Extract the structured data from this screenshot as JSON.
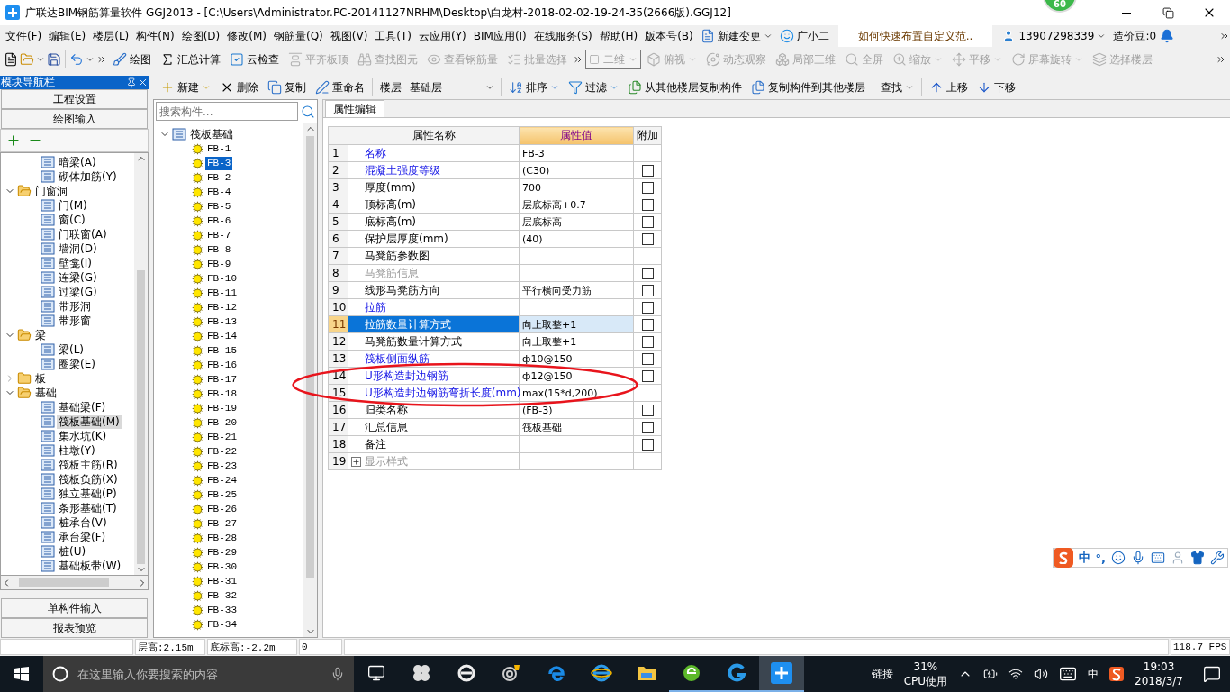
{
  "window": {
    "title": "广联达BIM钢筋算量软件 GGJ2013 - [C:\\Users\\Administrator.PC-20141127NRHM\\Desktop\\白龙村-2018-02-02-19-24-35(2666版).GGJ12]",
    "score_badge": "60"
  },
  "menu": [
    "文件(F)",
    "编辑(E)",
    "楼层(L)",
    "构件(N)",
    "绘图(D)",
    "修改(M)",
    "钢筋量(Q)",
    "视图(V)",
    "工具(T)",
    "云应用(Y)",
    "BIM应用(I)",
    "在线服务(S)",
    "帮助(H)",
    "版本号(B)"
  ],
  "menu_extra": {
    "change": "新建变更",
    "assistant": "广小二",
    "tip": "如何快速布置自定义范..",
    "account": "13907298339",
    "beans": "造价豆:0"
  },
  "toolbar": {
    "items": [
      {
        "label": "绘图",
        "disabled": false
      },
      {
        "label": "汇总计算",
        "disabled": false
      },
      {
        "label": "云检查",
        "disabled": false
      },
      {
        "label": "平齐板顶",
        "disabled": true
      },
      {
        "label": "查找图元",
        "disabled": true
      },
      {
        "label": "查看钢筋量",
        "disabled": true
      },
      {
        "label": "批量选择",
        "disabled": true
      }
    ],
    "view_select": "二维",
    "view_items": [
      {
        "label": "俯视",
        "disabled": true,
        "dropdown": true
      },
      {
        "label": "动态观察",
        "disabled": true,
        "dropdown": false
      },
      {
        "label": "局部三维",
        "disabled": true,
        "dropdown": false
      },
      {
        "label": "全屏",
        "disabled": true,
        "dropdown": false
      },
      {
        "label": "缩放",
        "disabled": true,
        "dropdown": true
      },
      {
        "label": "平移",
        "disabled": true,
        "dropdown": true
      },
      {
        "label": "屏幕旋转",
        "disabled": true,
        "dropdown": true
      },
      {
        "label": "选择楼层",
        "disabled": true,
        "dropdown": false
      }
    ]
  },
  "nav": {
    "title": "模块导航栏",
    "buttons": [
      "工程设置",
      "绘图输入"
    ],
    "bottom_buttons": [
      "单构件输入",
      "报表预览"
    ],
    "tree": [
      {
        "children": [
          {
            "label": "暗梁(A)",
            "selected": false
          },
          {
            "label": "砌体加筋(Y)",
            "selected": false
          }
        ]
      },
      {
        "label": "门窗洞",
        "expanded": true,
        "children": [
          {
            "label": "门(M)",
            "selected": false
          },
          {
            "label": "窗(C)",
            "selected": false
          },
          {
            "label": "门联窗(A)",
            "selected": false
          },
          {
            "label": "墙洞(D)",
            "selected": false
          },
          {
            "label": "壁龛(I)",
            "selected": false
          },
          {
            "label": "连梁(G)",
            "selected": false
          },
          {
            "label": "过梁(G)",
            "selected": false
          },
          {
            "label": "带形洞",
            "selected": false
          },
          {
            "label": "带形窗",
            "selected": false
          }
        ]
      },
      {
        "label": "梁",
        "expanded": true,
        "children": [
          {
            "label": "梁(L)",
            "selected": false
          },
          {
            "label": "圈梁(E)",
            "selected": false
          }
        ]
      },
      {
        "label": "板",
        "expanded": false
      },
      {
        "label": "基础",
        "expanded": true,
        "children": [
          {
            "label": "基础梁(F)",
            "selected": false
          },
          {
            "label": "筏板基础(M)",
            "selected": true
          },
          {
            "label": "集水坑(K)",
            "selected": false
          },
          {
            "label": "柱墩(Y)",
            "selected": false
          },
          {
            "label": "筏板主筋(R)",
            "selected": false
          },
          {
            "label": "筏板负筋(X)",
            "selected": false
          },
          {
            "label": "独立基础(P)",
            "selected": false
          },
          {
            "label": "条形基础(T)",
            "selected": false
          },
          {
            "label": "桩承台(V)",
            "selected": false
          },
          {
            "label": "承台梁(F)",
            "selected": false
          },
          {
            "label": "桩(U)",
            "selected": false
          },
          {
            "label": "基础板带(W)",
            "selected": false
          }
        ]
      }
    ]
  },
  "component_toolbar": {
    "items": [
      {
        "label": "新建",
        "dropdown": true
      },
      {
        "label": "删除",
        "dropdown": false
      },
      {
        "label": "复制",
        "dropdown": false
      },
      {
        "label": "重命名",
        "dropdown": false
      }
    ],
    "floor_label": "楼层",
    "floor_select": "基础层",
    "items2": [
      {
        "label": "排序",
        "dropdown": true
      },
      {
        "label": "过滤",
        "dropdown": true
      },
      {
        "label": "从其他楼层复制构件",
        "dropdown": false
      },
      {
        "label": "复制构件到其他楼层",
        "dropdown": false
      },
      {
        "label": "查找",
        "dropdown": true
      },
      {
        "label": "上移",
        "dropdown": false
      },
      {
        "label": "下移",
        "dropdown": false
      }
    ]
  },
  "component_search": {
    "placeholder": "搜索构件..."
  },
  "component_tree": {
    "label": "筏板基础",
    "expanded": true,
    "children": [
      {
        "label": "FB-1",
        "selected": false
      },
      {
        "label": "FB-3",
        "selected": true
      },
      {
        "label": "FB-2",
        "selected": false
      },
      {
        "label": "FB-4",
        "selected": false
      },
      {
        "label": "FB-5",
        "selected": false
      },
      {
        "label": "FB-6",
        "selected": false
      },
      {
        "label": "FB-7",
        "selected": false
      },
      {
        "label": "FB-8",
        "selected": false
      },
      {
        "label": "FB-9",
        "selected": false
      },
      {
        "label": "FB-10",
        "selected": false
      },
      {
        "label": "FB-11",
        "selected": false
      },
      {
        "label": "FB-12",
        "selected": false
      },
      {
        "label": "FB-13",
        "selected": false
      },
      {
        "label": "FB-14",
        "selected": false
      },
      {
        "label": "FB-15",
        "selected": false
      },
      {
        "label": "FB-16",
        "selected": false
      },
      {
        "label": "FB-17",
        "selected": false
      },
      {
        "label": "FB-18",
        "selected": false
      },
      {
        "label": "FB-19",
        "selected": false
      },
      {
        "label": "FB-20",
        "selected": false
      },
      {
        "label": "FB-21",
        "selected": false
      },
      {
        "label": "FB-22",
        "selected": false
      },
      {
        "label": "FB-23",
        "selected": false
      },
      {
        "label": "FB-24",
        "selected": false
      },
      {
        "label": "FB-25",
        "selected": false
      },
      {
        "label": "FB-26",
        "selected": false
      },
      {
        "label": "FB-27",
        "selected": false
      },
      {
        "label": "FB-28",
        "selected": false
      },
      {
        "label": "FB-29",
        "selected": false
      },
      {
        "label": "FB-30",
        "selected": false
      },
      {
        "label": "FB-31",
        "selected": false
      },
      {
        "label": "FB-32",
        "selected": false
      },
      {
        "label": "FB-33",
        "selected": false
      },
      {
        "label": "FB-34",
        "selected": false
      }
    ]
  },
  "properties": {
    "tab": "属性编辑",
    "columns": [
      "属性名称",
      "属性值",
      "附加"
    ],
    "rows": [
      {
        "num": "1",
        "name": "名称",
        "kind": "link",
        "value": "FB-3",
        "selected": false
      },
      {
        "num": "2",
        "name": "混凝土强度等级",
        "kind": "link",
        "value": "(C30)",
        "checked": false,
        "selected": false
      },
      {
        "num": "3",
        "name": "厚度(mm)",
        "kind": "plain",
        "value": "700",
        "checked": false,
        "selected": false
      },
      {
        "num": "4",
        "name": "顶标高(m)",
        "kind": "plain",
        "value": "层底标高+0.7",
        "checked": false,
        "selected": false
      },
      {
        "num": "5",
        "name": "底标高(m)",
        "kind": "plain",
        "value": "层底标高",
        "checked": false,
        "selected": false
      },
      {
        "num": "6",
        "name": "保护层厚度(mm)",
        "kind": "plain",
        "value": "(40)",
        "checked": false,
        "selected": false
      },
      {
        "num": "7",
        "name": "马凳筋参数图",
        "kind": "plain",
        "selected": false
      },
      {
        "num": "8",
        "name": "马凳筋信息",
        "kind": "disabled",
        "checked": false,
        "selected": false
      },
      {
        "num": "9",
        "name": "线形马凳筋方向",
        "kind": "plain",
        "value": "平行横向受力筋",
        "checked": false,
        "selected": false
      },
      {
        "num": "10",
        "name": "拉筋",
        "kind": "link",
        "checked": false,
        "selected": false
      },
      {
        "num": "11",
        "name": "拉筋数量计算方式",
        "kind": "plain",
        "value": "向上取整+1",
        "checked": false,
        "selected": true
      },
      {
        "num": "12",
        "name": "马凳筋数量计算方式",
        "kind": "plain",
        "value": "向上取整+1",
        "checked": false,
        "selected": false
      },
      {
        "num": "13",
        "name": "筏板侧面纵筋",
        "kind": "link",
        "value": "ф10@150",
        "checked": false,
        "selected": false
      },
      {
        "num": "14",
        "name": "U形构造封边钢筋",
        "kind": "link",
        "value": "ф12@150",
        "checked": false,
        "selected": false
      },
      {
        "num": "15",
        "name": "U形构造封边钢筋弯折长度(mm)",
        "kind": "link",
        "value": "max(15*d,200)",
        "selected": false
      },
      {
        "num": "16",
        "name": "归类名称",
        "kind": "plain",
        "value": "(FB-3)",
        "checked": false,
        "selected": false
      },
      {
        "num": "17",
        "name": "汇总信息",
        "kind": "plain",
        "value": "筏板基础",
        "checked": false,
        "selected": false
      },
      {
        "num": "18",
        "name": "备注",
        "kind": "plain",
        "checked": false,
        "selected": false
      },
      {
        "num": "19",
        "name": "显示样式",
        "kind": "group",
        "expanded": false,
        "selected": false
      }
    ]
  },
  "ime_bar": {
    "mode": "中",
    "punct": "°,"
  },
  "status_bar": {
    "cells": [
      "层高:2.15m",
      "底标高:-2.2m",
      "0"
    ],
    "fps": "118.7 FPS"
  },
  "taskbar": {
    "search_placeholder": "在这里输入你要搜索的内容",
    "apps": [
      {
        "kind": "task-view",
        "running": false,
        "active": false
      },
      {
        "kind": "pinwheel",
        "running": false,
        "active": false
      },
      {
        "kind": "ie-legacy",
        "running": false,
        "active": false
      },
      {
        "kind": "cloud",
        "running": false,
        "active": false
      },
      {
        "kind": "edge",
        "running": false,
        "active": false
      },
      {
        "kind": "ie",
        "running": false,
        "active": false
      },
      {
        "kind": "folder",
        "running": false,
        "active": false
      },
      {
        "kind": "green-browser",
        "running": true,
        "active": false
      },
      {
        "kind": "g-app",
        "running": true,
        "active": false
      },
      {
        "kind": "ggj",
        "running": true,
        "active": true
      }
    ],
    "link_label": "链接",
    "cpu_percent": "31%",
    "cpu_label": "CPU使用",
    "ime": "中",
    "time": "19:03",
    "date": "2018/3/7"
  }
}
